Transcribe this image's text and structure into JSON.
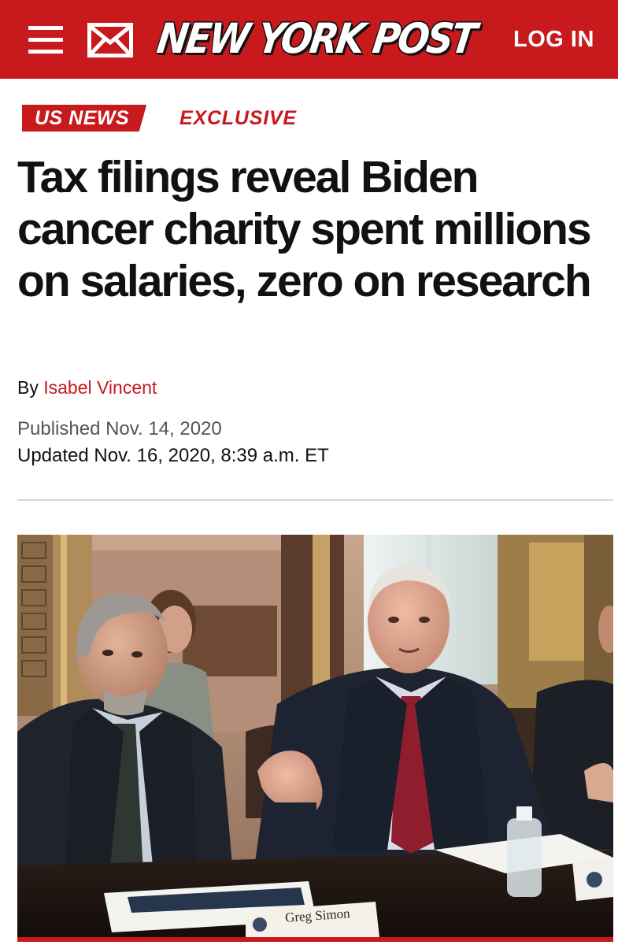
{
  "header": {
    "logo": "NEW YORK POST",
    "login_label": "LOG IN",
    "menu_icon": "hamburger-menu-icon",
    "mail_icon": "envelope-icon",
    "brand_color": "#c8191d"
  },
  "article": {
    "section": "US NEWS",
    "label": "EXCLUSIVE",
    "headline": "Tax filings reveal Biden cancer charity spent millions on salaries, zero on research",
    "byline_prefix": "By",
    "author": "Isabel Vincent",
    "published": "Published Nov. 14, 2020",
    "updated": "Updated Nov. 16, 2020, 8:39 a.m. ET"
  },
  "photo": {
    "nameplate_text": "Greg Simon"
  }
}
